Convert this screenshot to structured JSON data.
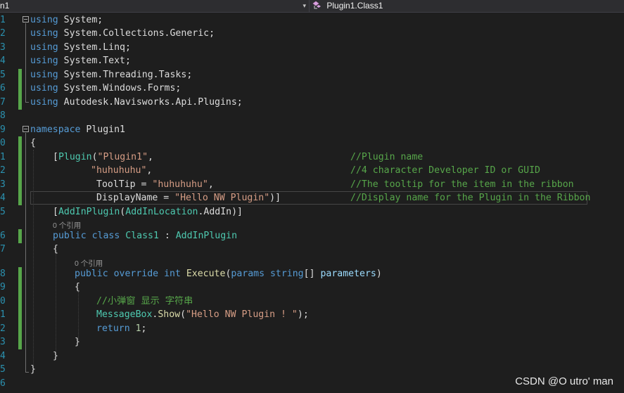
{
  "navbar": {
    "left_text": "n1",
    "right_text": "Plugin1.Class1",
    "dropdown_glyph": "▾"
  },
  "line_numbers": [
    "1",
    "2",
    "3",
    "4",
    "5",
    "6",
    "7",
    "8",
    "9",
    "0",
    "1",
    "2",
    "3",
    "4",
    "5",
    "6",
    "7",
    "8",
    "9",
    "0",
    "1",
    "2",
    "3",
    "4",
    "5",
    "6"
  ],
  "hints": {
    "refs_1": "0 个引用",
    "refs_2": "0 个引用"
  },
  "code": {
    "l1": [
      "using",
      " System;"
    ],
    "l2": [
      "using",
      " System.Collections.Generic;"
    ],
    "l3": [
      "using",
      " System.Linq;"
    ],
    "l4": [
      "using",
      " System.Text;"
    ],
    "l5": [
      "using",
      " System.Threading.Tasks;"
    ],
    "l6": [
      "using",
      " System.Windows.Forms;"
    ],
    "l7": [
      "using",
      " Autodesk.Navisworks.Api.Plugins;"
    ],
    "l9": [
      "namespace",
      " Plugin1"
    ],
    "l10": "{",
    "l11": [
      "[",
      "Plugin",
      "(",
      "\"Plugin1\"",
      ",",
      "//Plugin name"
    ],
    "l12": [
      "\"huhuhuhu\"",
      ",",
      "//4 character Developer ID or GUID"
    ],
    "l13": [
      "ToolTip",
      " = ",
      "\"huhuhuhu\"",
      ",",
      "//The tooltip for the item in the ribbon"
    ],
    "l14": [
      "DisplayName",
      " = ",
      "\"Hello NW Plugin\"",
      ")]",
      "//Display name for the Plugin in the Ribbon"
    ],
    "l15": [
      "[",
      "AddInPlugin",
      "(",
      "AddInLocation",
      ".AddIn)]"
    ],
    "l16": [
      "public",
      " ",
      "class",
      " ",
      "Class1",
      " : ",
      "AddInPlugin"
    ],
    "l17": "{",
    "l18": [
      "public",
      " ",
      "override",
      " ",
      "int",
      " ",
      "Execute",
      "(",
      "params",
      " ",
      "string",
      "[] ",
      "parameters",
      ")"
    ],
    "l19": "{",
    "l20": "//小弹窗 显示 字符串",
    "l21": [
      "MessageBox",
      ".",
      "Show",
      "(",
      "\"Hello NW Plugin ! \"",
      ");"
    ],
    "l22": [
      "return",
      " ",
      "1",
      ";"
    ],
    "l23": "}",
    "l24": "}",
    "l25": "}"
  },
  "watermark": "CSDN @O utro' man",
  "colors": {
    "keyword": "#569cd6",
    "type": "#4ec9b0",
    "string": "#d69d85",
    "comment": "#57a64a",
    "method": "#dcdcaa",
    "param": "#9cdcfe",
    "number": "#b5cea8",
    "line_number": "#2b91af",
    "change_bar": "#57a64a"
  }
}
